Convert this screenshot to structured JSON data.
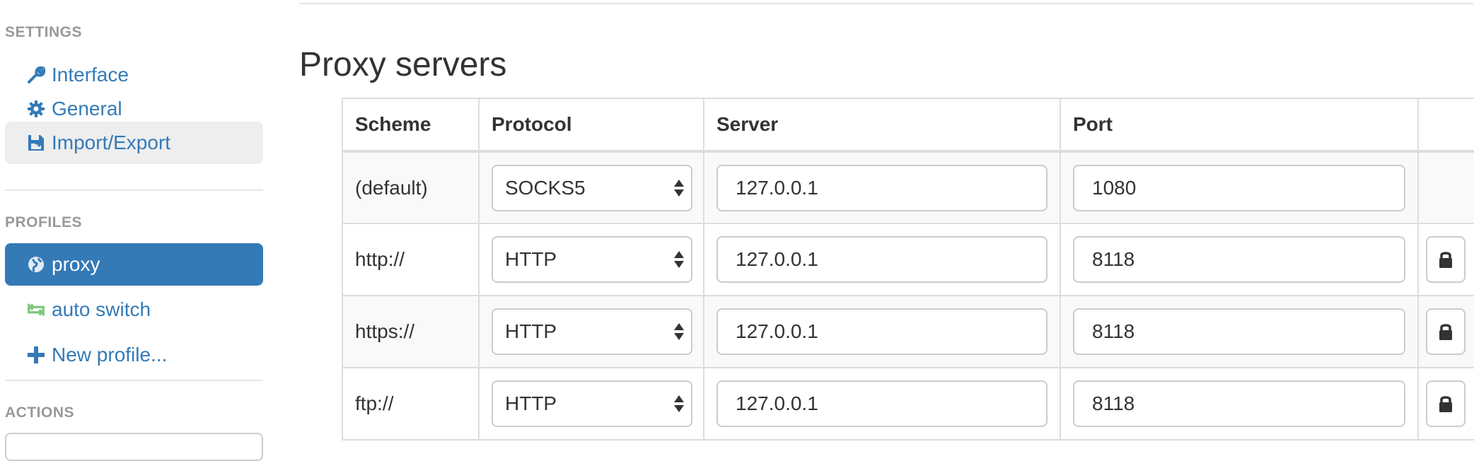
{
  "sidebar": {
    "settings_header": "SETTINGS",
    "settings_items": [
      {
        "label": "Interface",
        "icon": "wrench-icon"
      },
      {
        "label": "General",
        "icon": "gear-icon"
      },
      {
        "label": "Import/Export",
        "icon": "floppy-disk-icon"
      }
    ],
    "profiles_header": "PROFILES",
    "profile_items": [
      {
        "label": "proxy",
        "icon": "globe-icon"
      },
      {
        "label": "auto switch",
        "icon": "switch-arrows-icon"
      },
      {
        "label": "New profile...",
        "icon": "plus-icon"
      }
    ],
    "actions_header": "ACTIONS"
  },
  "main": {
    "title": "Proxy servers",
    "table": {
      "columns": [
        "Scheme",
        "Protocol",
        "Server",
        "Port"
      ],
      "rows": [
        {
          "scheme": "(default)",
          "protocol": "SOCKS5",
          "server": "127.0.0.1",
          "port": "1080"
        },
        {
          "scheme": "http://",
          "protocol": "HTTP",
          "server": "127.0.0.1",
          "port": "8118"
        },
        {
          "scheme": "https://",
          "protocol": "HTTP",
          "server": "127.0.0.1",
          "port": "8118"
        },
        {
          "scheme": "ftp://",
          "protocol": "HTTP",
          "server": "127.0.0.1",
          "port": "8118"
        }
      ]
    }
  },
  "colors": {
    "accent": "#337ab7",
    "sidebar_header": "#999999",
    "border": "#cccccc",
    "switch_icon": "#7ec67e"
  }
}
